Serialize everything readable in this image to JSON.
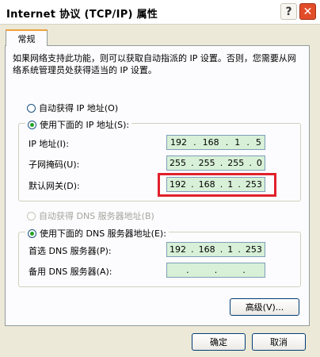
{
  "window": {
    "title": "Internet 协议 (TCP/IP) 属性",
    "help": "?",
    "close": "✕"
  },
  "tab": {
    "label": "常规"
  },
  "description": "如果网络支持此功能，则可以获取自动指派的 IP 设置。否则，您需要从网络系统管理员处获得适当的 IP 设置。",
  "ip": {
    "auto_label": "自动获得 IP 地址(O)",
    "manual_label": "使用下面的 IP 地址(S):",
    "address_label": "IP 地址(I):",
    "address": [
      "192",
      "168",
      "1",
      "5"
    ],
    "mask_label": "子网掩码(U):",
    "mask": [
      "255",
      "255",
      "255",
      "0"
    ],
    "gateway_label": "默认网关(D):",
    "gateway": [
      "192",
      "168",
      "1",
      "253"
    ]
  },
  "dns": {
    "auto_label": "自动获得 DNS 服务器地址(B)",
    "manual_label": "使用下面的 DNS 服务器地址(E):",
    "preferred_label": "首选 DNS 服务器(P):",
    "preferred": [
      "192",
      "168",
      "1",
      "253"
    ],
    "alternate_label": "备用 DNS 服务器(A):",
    "alternate": [
      "",
      "",
      "",
      ""
    ]
  },
  "buttons": {
    "advanced": "高级(V)...",
    "ok": "确定",
    "cancel": "取消"
  },
  "colors": {
    "highlight": "#e0202a",
    "field_bg": "#d7f0d7",
    "radio_dot": "#22a322"
  }
}
